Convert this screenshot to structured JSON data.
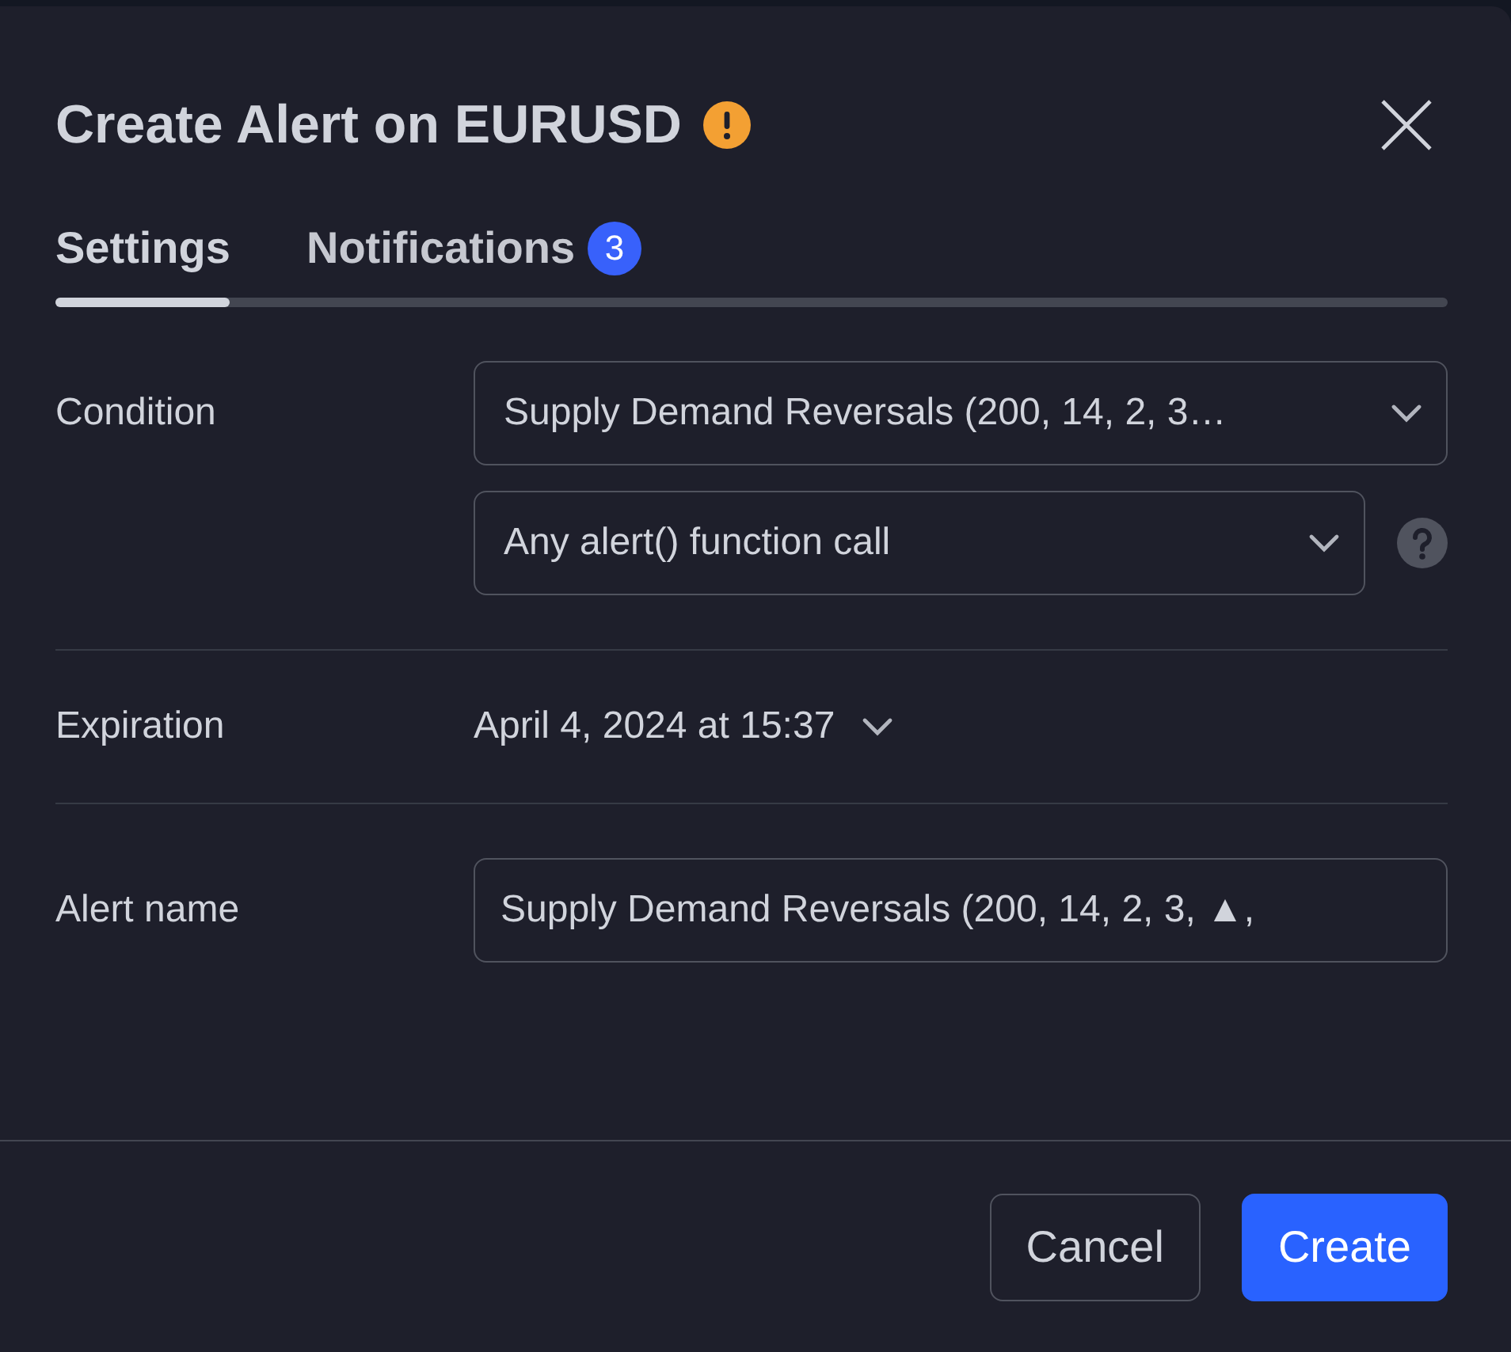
{
  "dialog": {
    "title": "Create Alert on EURUSD",
    "warning": true
  },
  "tabs": [
    {
      "label": "Settings",
      "selected": true
    },
    {
      "label": "Notifications",
      "selected": false,
      "badge": "3"
    }
  ],
  "sections": [
    {
      "kind": "selects",
      "label": "Condition",
      "selects": [
        {
          "value": "Supply Demand Reversals (200, 14, 2, 3…",
          "help": false
        },
        {
          "value": "Any alert() function call",
          "help": true
        }
      ]
    },
    {
      "kind": "dropdown",
      "label": "Expiration",
      "value": "April 4, 2024 at 15:37"
    },
    {
      "kind": "text",
      "label": "Alert name",
      "value": "Supply Demand Reversals (200, 14, 2, 3, ▲,"
    }
  ],
  "buttons": [
    {
      "label": "Cancel",
      "kind": "secondary"
    },
    {
      "label": "Create",
      "kind": "primary"
    }
  ]
}
